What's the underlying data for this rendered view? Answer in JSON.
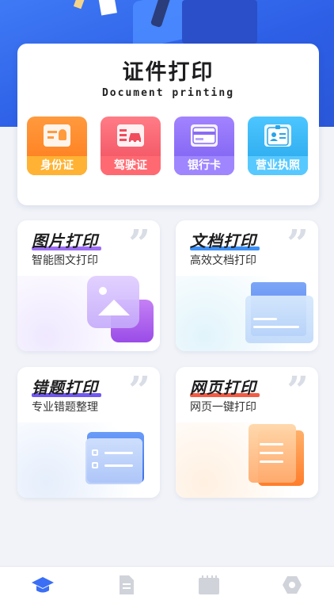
{
  "document_section": {
    "title": "证件打印",
    "subtitle": "Document printing",
    "items": [
      {
        "label": "身份证",
        "icon": "id-card-icon"
      },
      {
        "label": "驾驶证",
        "icon": "car-icon"
      },
      {
        "label": "银行卡",
        "icon": "bank-card-icon"
      },
      {
        "label": "营业执照",
        "icon": "business-license-icon"
      }
    ]
  },
  "features": [
    {
      "title": "图片打印",
      "desc": "智能图文打印",
      "icon": "image-icon",
      "accent": "#9d6df5"
    },
    {
      "title": "文档打印",
      "desc": "高效文档打印",
      "icon": "folder-icon",
      "accent": "#3b8ff6"
    },
    {
      "title": "错题打印",
      "desc": "专业错题整理",
      "icon": "clipboard-icon",
      "accent": "#7057f0"
    },
    {
      "title": "网页打印",
      "desc": "网页一键打印",
      "icon": "webpage-icon",
      "accent": "#f35a43"
    }
  ],
  "tabbar": {
    "items": [
      {
        "name": "home",
        "icon": "graduation-cap-icon",
        "active": true
      },
      {
        "name": "documents",
        "icon": "document-icon",
        "active": false
      },
      {
        "name": "calendar",
        "icon": "calendar-icon",
        "active": false
      },
      {
        "name": "settings",
        "icon": "hexagon-settings-icon",
        "active": false
      }
    ]
  },
  "colors": {
    "primary": "#2d5fe6",
    "tab_active": "#3a6ef5",
    "tab_inactive": "#d0d3da"
  }
}
